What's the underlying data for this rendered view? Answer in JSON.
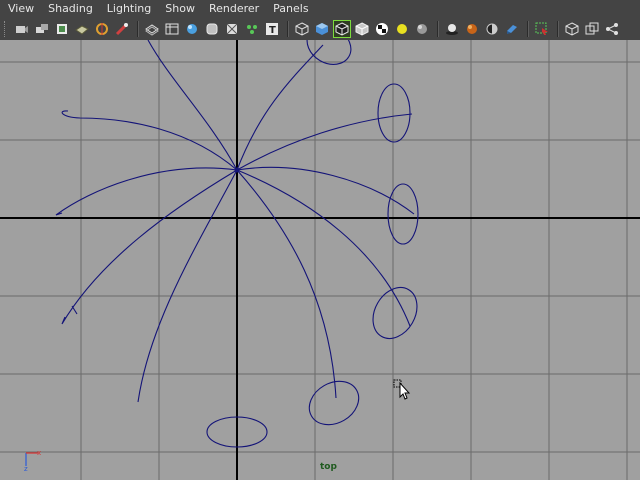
{
  "menubar": {
    "items": [
      "View",
      "Shading",
      "Lighting",
      "Show",
      "Renderer",
      "Panels"
    ]
  },
  "toolbar": {
    "groups": [
      [
        "camera-attributes-icon",
        "bookmark-icon",
        "image-plane-icon",
        "grid-icon",
        "film-gate-icon",
        "resolution-gate-icon"
      ],
      [
        "wireframe-icon",
        "hud-icon",
        "smooth-shade-icon",
        "flat-shade-icon",
        "xray-icon",
        "texture-icon",
        "text-icon"
      ],
      [
        "wireframe-cube-icon",
        "smooth-cube-icon",
        "wireframe-on-shaded-icon",
        "shaded-cube-icon",
        "checker-icon",
        "light-icon",
        "sphere-icon"
      ],
      [
        "shadow-icon",
        "ambient-occlusion-icon",
        "hardware-fog-icon",
        "motion-blur-icon"
      ],
      [
        "isolate-select-icon"
      ],
      [
        "single-view-icon",
        "two-view-icon",
        "hypershade-icon"
      ]
    ],
    "active": "wireframe-on-shaded-icon"
  },
  "viewport": {
    "camera_label": "top",
    "axis_labels": {
      "x": "x",
      "z": "z"
    },
    "background": "#a0a0a0",
    "grid_color": "#6a6a6a",
    "axis_color": "#000000",
    "curve_color": "#141478"
  },
  "colors": {
    "menubar_bg": "#444444",
    "menu_text": "#e6e6e6",
    "active_border": "#7cdc3c"
  }
}
